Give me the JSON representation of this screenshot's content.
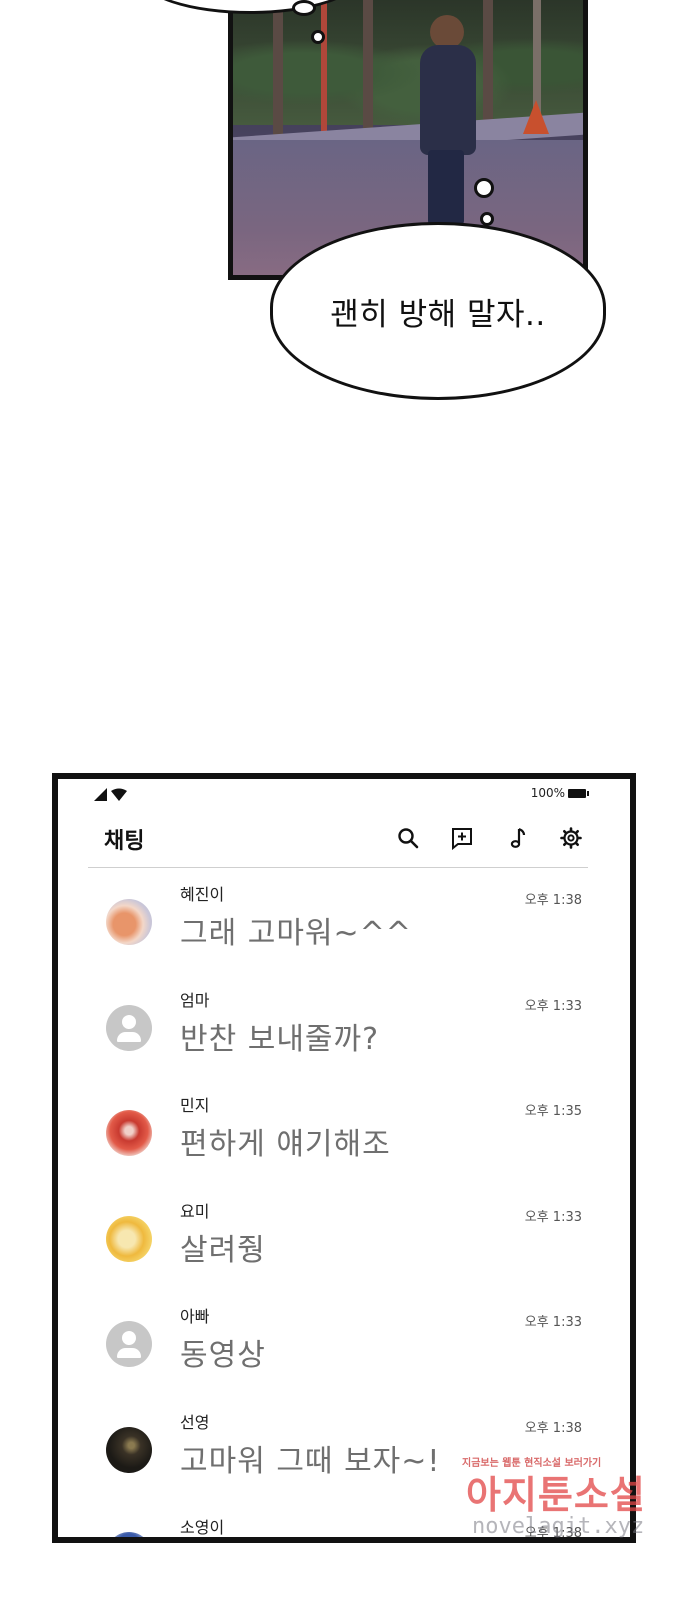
{
  "comic": {
    "speech_text": "괜히 방해 말자.."
  },
  "phone": {
    "status": {
      "battery": "100%"
    },
    "header": {
      "title": "채팅",
      "icons": [
        "search-icon",
        "new-chat-icon",
        "music-note-icon",
        "gear-icon"
      ]
    },
    "chats": [
      {
        "name": "혜진이",
        "message": "그래 고마워~^^",
        "time": "오후 1:38",
        "avatar": "photo-orange"
      },
      {
        "name": "엄마",
        "message": "반찬 보내줄까?",
        "time": "오후 1:33",
        "avatar": "default"
      },
      {
        "name": "민지",
        "message": "편하게 얘기해조",
        "time": "오후 1:35",
        "avatar": "photo-red"
      },
      {
        "name": "요미",
        "message": "살려줭",
        "time": "오후 1:33",
        "avatar": "photo-yellow"
      },
      {
        "name": "아빠",
        "message": "동영상",
        "time": "오후 1:33",
        "avatar": "default"
      },
      {
        "name": "선영",
        "message": "고마워 그때 보자~!",
        "time": "오후 1:38",
        "avatar": "photo-dark"
      },
      {
        "name": "소영이",
        "message": "",
        "time": "오후 1:38",
        "avatar": "photo-blue"
      }
    ]
  },
  "watermark": {
    "tagline": "지금보는 웹툰 현직소설 보러가기",
    "brand": "아지툰소설",
    "url": "novelagit.xyz"
  }
}
